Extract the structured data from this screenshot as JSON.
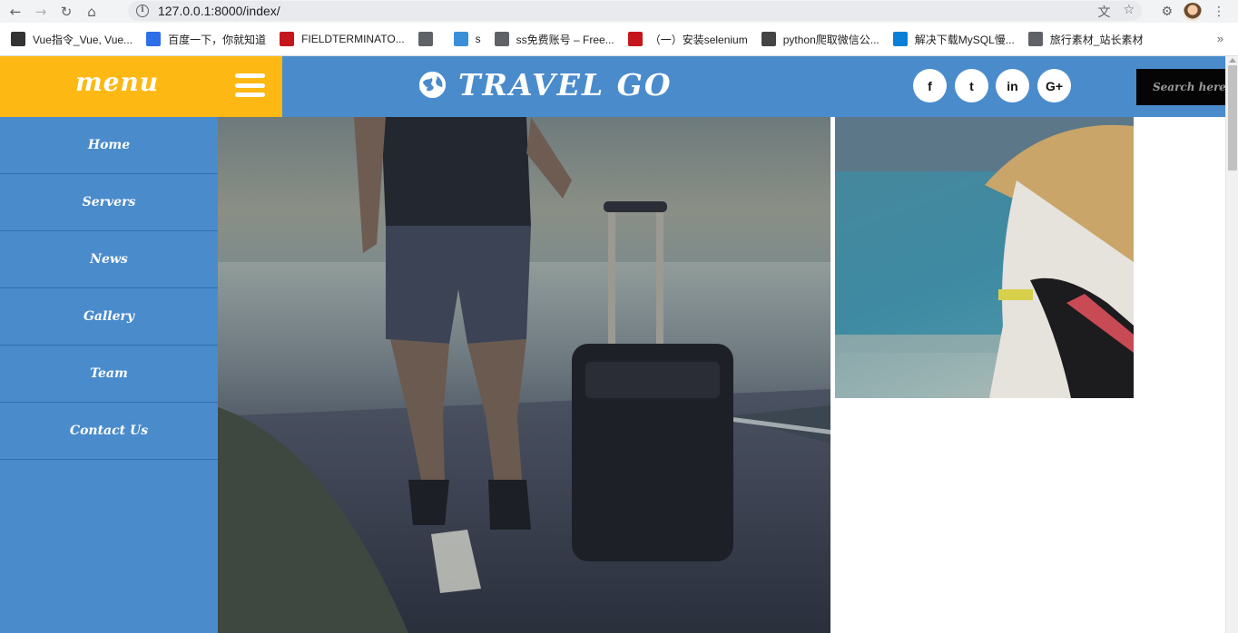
{
  "browser": {
    "url": "127.0.0.1:8000/index/",
    "bookmarks": [
      {
        "label": "Vue指令_Vue, Vue...",
        "icon_color": "#333333",
        "icon": "vue-icon"
      },
      {
        "label": "百度一下，你就知道",
        "icon_color": "#2e6ee6",
        "icon": "baidu-icon"
      },
      {
        "label": "FIELDTERMINATO...",
        "icon_color": "#c4161c",
        "icon": "csdn-icon"
      },
      {
        "label": "",
        "icon_color": "#5f6368",
        "icon": "globe-icon"
      },
      {
        "label": "s",
        "icon_color": "#3b8fd8",
        "icon": "diamond-icon"
      },
      {
        "label": "ss免费账号 – Free...",
        "icon_color": "#5f6368",
        "icon": "globe-icon"
      },
      {
        "label": "（一）安装selenium",
        "icon_color": "#c4161c",
        "icon": "splash-icon"
      },
      {
        "label": "python爬取微信公...",
        "icon_color": "#444444",
        "icon": "feather-icon"
      },
      {
        "label": "解决下载MySQL慢...",
        "icon_color": "#0a7fd8",
        "icon": "zhihu-icon"
      },
      {
        "label": "旅行素材_站长素材",
        "icon_color": "#5f6368",
        "icon": "globe-icon"
      }
    ]
  },
  "site": {
    "menu_label": "menu",
    "brand": "TRAVEL GO",
    "search_placeholder": "Search here...",
    "social": [
      {
        "name": "facebook-icon",
        "glyph": "f"
      },
      {
        "name": "twitter-icon",
        "glyph": "t"
      },
      {
        "name": "linkedin-icon",
        "glyph": "in"
      },
      {
        "name": "google-plus-icon",
        "glyph": "G+"
      }
    ],
    "nav": [
      "Home",
      "Servers",
      "News",
      "Gallery",
      "Team",
      "Contact Us"
    ],
    "colors": {
      "accent": "#fdb813",
      "primary": "#4a8bcc",
      "search_bg": "#050505"
    }
  }
}
